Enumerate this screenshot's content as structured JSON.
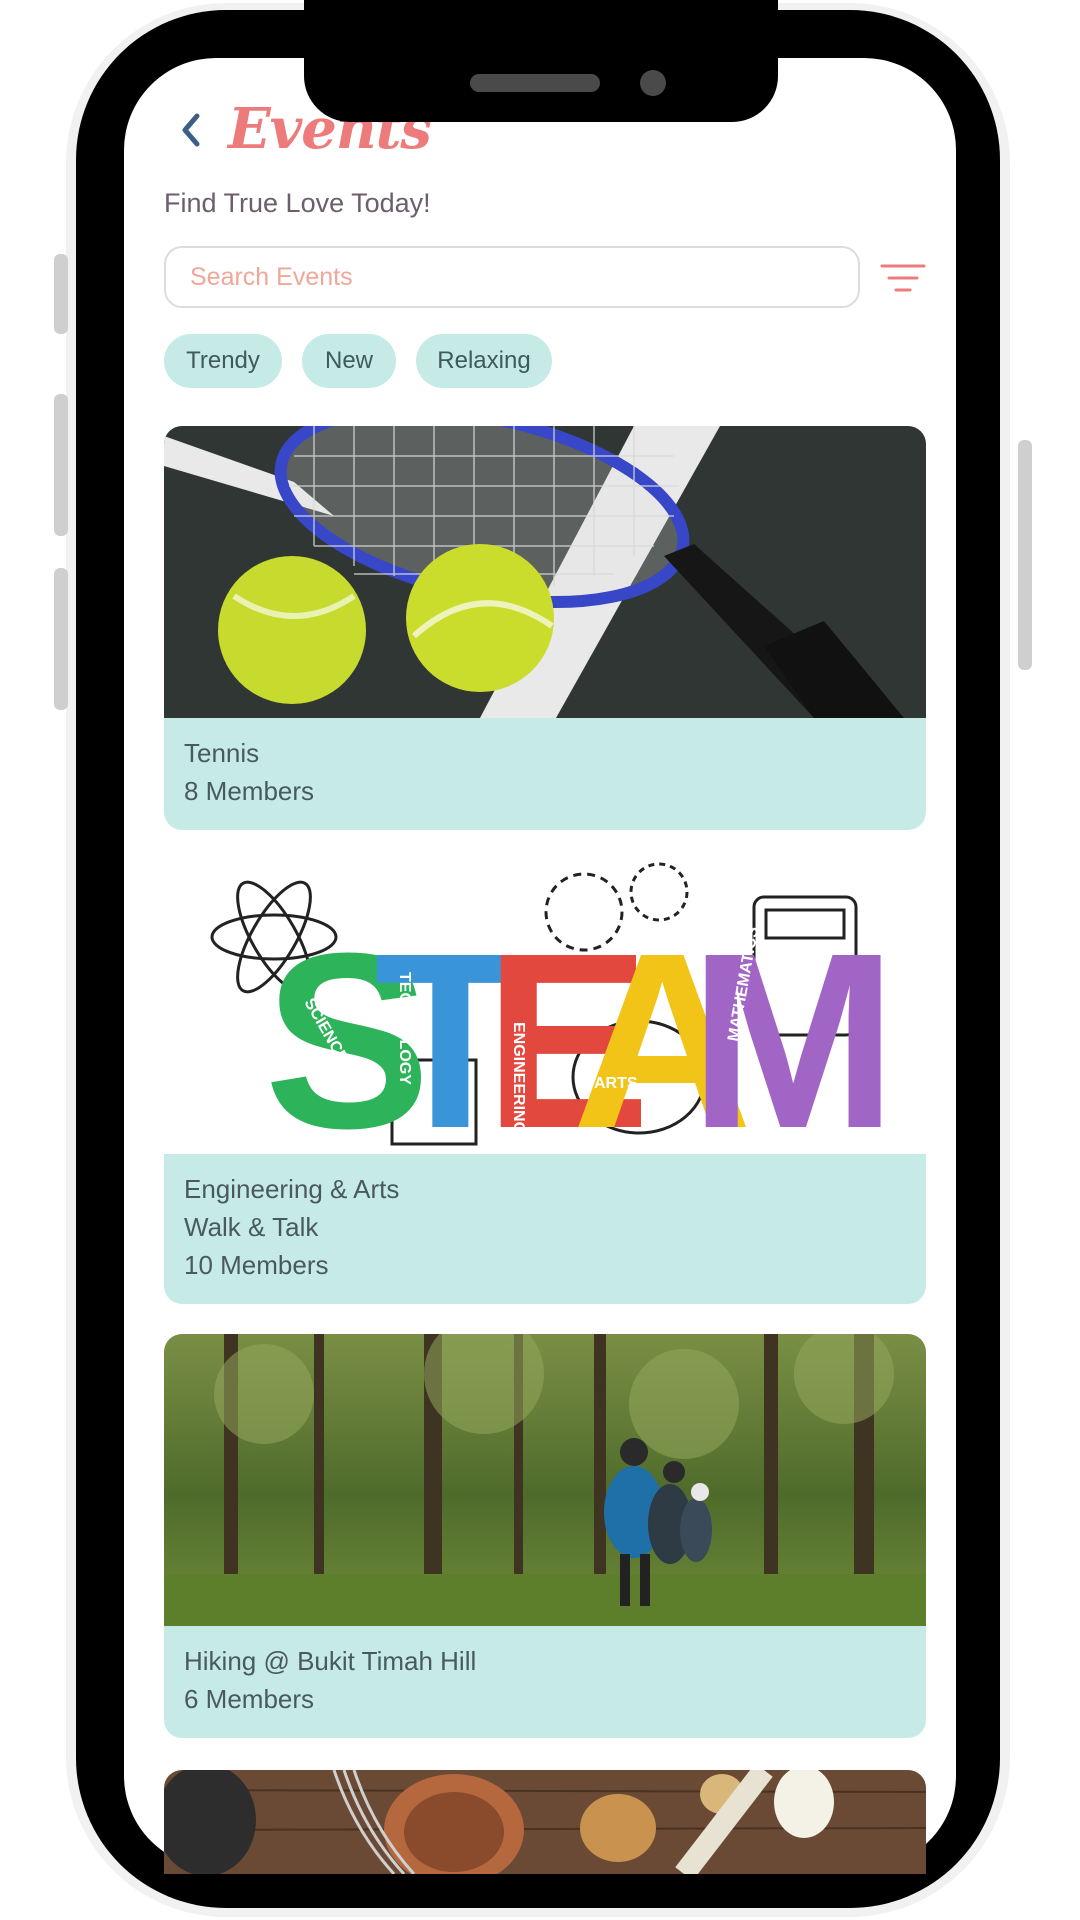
{
  "header": {
    "back_icon": "chevron-left-icon",
    "title": "Events",
    "subtitle": "Find True Love Today!"
  },
  "search": {
    "placeholder": "Search Events",
    "filter_icon": "filter-icon"
  },
  "chips": [
    "Trendy",
    "New",
    "Relaxing"
  ],
  "events": [
    {
      "title": "Tennis",
      "members": "8 Members",
      "image": "tennis-racket-and-balls"
    },
    {
      "title": "Engineering & Arts",
      "subtitle": "Walk & Talk",
      "members": "10 Members",
      "image": "steam-logo",
      "steam": {
        "letters": [
          "S",
          "T",
          "E",
          "A",
          "M"
        ],
        "words": [
          "SCIENCE",
          "TECHNOLOGY",
          "ENGINEERING",
          "ARTS",
          "MATHEMATICS"
        ]
      }
    },
    {
      "title": "Hiking @ Bukit Timah Hill",
      "members": "6 Members",
      "image": "forest-hikers"
    },
    {
      "image": "kitchen-utensils"
    }
  ],
  "colors": {
    "accent": "#ee7b7b",
    "chip_bg": "#c6ebe7",
    "card_bg": "#c6ebe7",
    "placeholder": "#f0a79a",
    "steam_s": "#2db35a",
    "steam_t": "#3a95d8",
    "steam_e": "#e2483e",
    "steam_a": "#f2c417",
    "steam_m": "#a165c6"
  }
}
